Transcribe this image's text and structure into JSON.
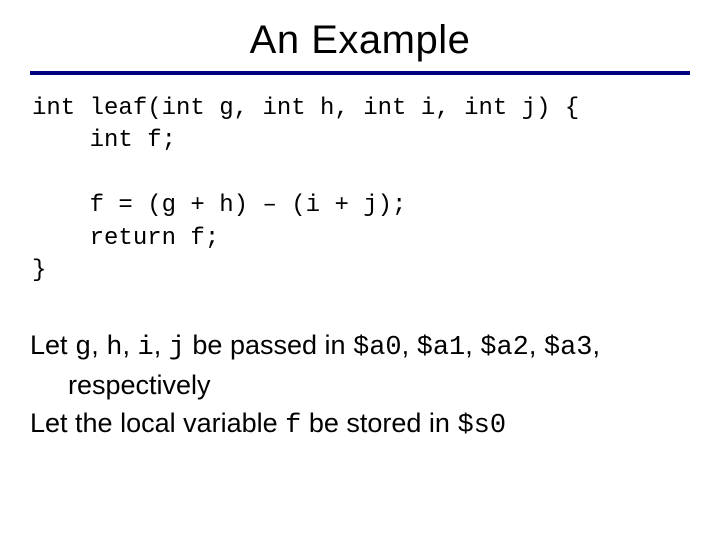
{
  "title": "An Example",
  "code": "int leaf(int g, int h, int i, int j) {\n    int f;\n\n    f = (g + h) – (i + j);\n    return f;\n}",
  "body": {
    "p1_a": "Let ",
    "p1_g": "g",
    "p1_c1": ", ",
    "p1_h": "h",
    "p1_c2": ", ",
    "p1_i": "i",
    "p1_c3": ", ",
    "p1_j": "j",
    "p1_b": " be passed in ",
    "p1_a0": "$a0",
    "p1_c4": ", ",
    "p1_a1": "$a1",
    "p1_c5": ", ",
    "p1_a2": "$a2",
    "p1_c6": ", ",
    "p1_a3": "$a3",
    "p1_d": ", respectively",
    "p2_a": "Let the local variable ",
    "p2_f": "f",
    "p2_b": " be stored in ",
    "p2_s0": "$s0"
  }
}
